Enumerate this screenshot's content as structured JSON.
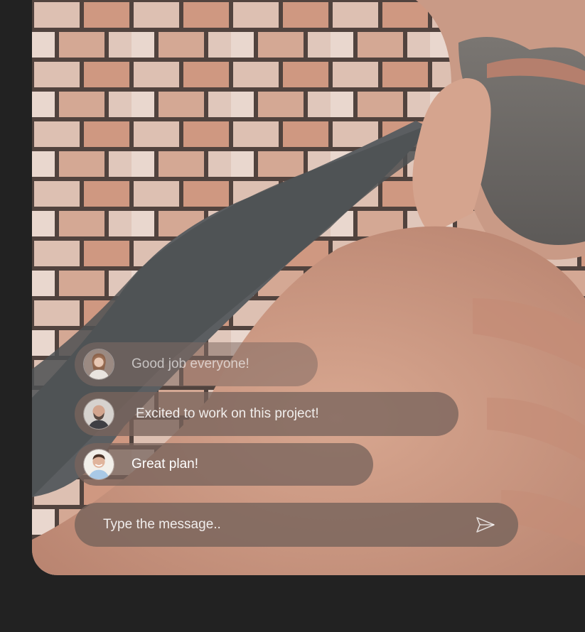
{
  "chat": {
    "messages": [
      {
        "text": "Good job everyone!",
        "avatar": "woman-avatar"
      },
      {
        "text": "Excited to work on this project!",
        "avatar": "bearded-man-avatar"
      },
      {
        "text": "Great plan!",
        "avatar": "smiling-man-avatar"
      }
    ],
    "input": {
      "placeholder": "Type the message..",
      "value": ""
    },
    "send_icon": "send-icon"
  },
  "colors": {
    "page_background": "#222222",
    "bubble_background": "#786458",
    "text": "#ffffff"
  }
}
